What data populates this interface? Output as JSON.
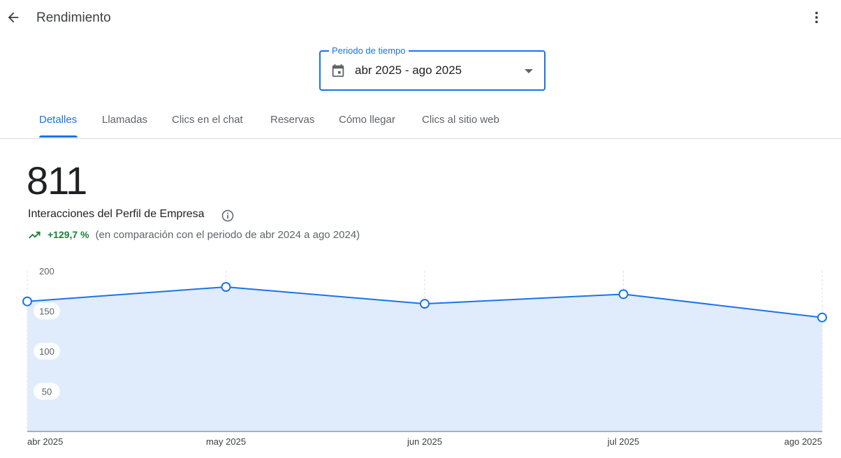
{
  "header": {
    "title": "Rendimiento"
  },
  "period": {
    "label": "Periodo de tiempo",
    "value": "abr 2025 - ago 2025"
  },
  "tabs": [
    {
      "label": "Detalles",
      "active": true
    },
    {
      "label": "Llamadas"
    },
    {
      "label": "Clics en el chat"
    },
    {
      "label": "Reservas"
    },
    {
      "label": "Cómo llegar"
    },
    {
      "label": "Clics al sitio web"
    }
  ],
  "summary": {
    "total": "811",
    "metric_label": "Interacciones del Perfil de Empresa",
    "change": "+129,7 %",
    "comparison": "(en comparación con el periodo de abr 2024 a ago 2024)"
  },
  "colors": {
    "accent": "#1a73e8",
    "positive": "#188038",
    "area_fill": "#e0ecfc"
  },
  "chart_data": {
    "type": "area",
    "x": [
      "abr 2025",
      "may 2025",
      "jun 2025",
      "jul 2025",
      "ago 2025"
    ],
    "values": [
      162,
      180,
      159,
      171,
      142
    ],
    "yticks": [
      200,
      150,
      100,
      50
    ],
    "ylim": [
      0,
      200
    ],
    "grid": "vertical-dashed"
  }
}
